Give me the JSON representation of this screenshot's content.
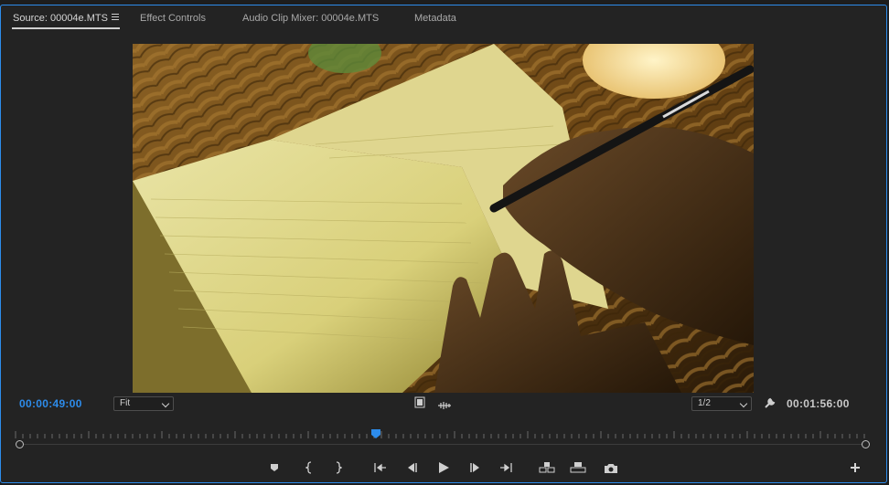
{
  "tabs": [
    {
      "label": "Source: 00004e.MTS",
      "active": true
    },
    {
      "label": "Effect Controls",
      "active": false
    },
    {
      "label": "Audio Clip Mixer: 00004e.MTS",
      "active": false
    },
    {
      "label": "Metadata",
      "active": false
    }
  ],
  "timecode": {
    "current": "00:00:49:00",
    "duration": "00:01:56:00"
  },
  "zoom": {
    "selected": "Fit"
  },
  "resolution": {
    "selected": "1/2"
  },
  "playhead_fraction": 0.423,
  "colors": {
    "accent": "#2d8ceb",
    "panel_bg": "#232323"
  },
  "transport": [
    "add-marker",
    "mark-in",
    "mark-out",
    "go-to-in",
    "step-back",
    "play",
    "step-forward",
    "go-to-out",
    "insert",
    "overwrite",
    "export-frame"
  ]
}
